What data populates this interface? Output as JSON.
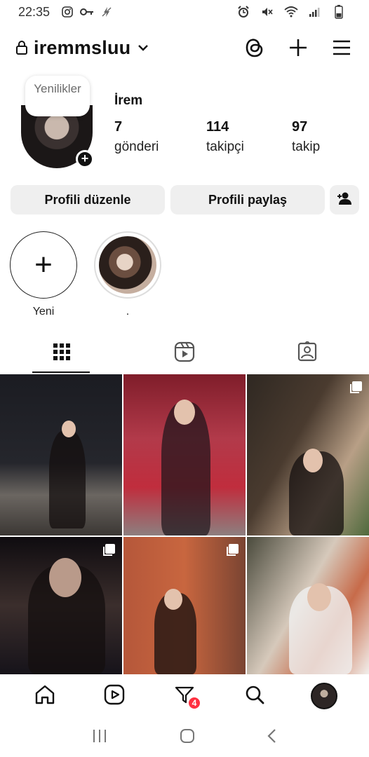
{
  "status_bar": {
    "time": "22:35",
    "left_icons": [
      "instagram-icon",
      "key-icon",
      "no-charge-icon"
    ],
    "right_icons": [
      "alarm-icon",
      "mute-icon",
      "wifi-icon",
      "signal-icon",
      "battery-icon"
    ]
  },
  "header": {
    "username": "iremmsluu",
    "actions": [
      "threads-icon",
      "plus-icon",
      "menu-icon"
    ]
  },
  "profile": {
    "note": "Yenilikler",
    "display_name": "İrem",
    "stats": [
      {
        "value": "7",
        "label": "gönderi"
      },
      {
        "value": "114",
        "label": "takipçi"
      },
      {
        "value": "97",
        "label": "takip"
      }
    ]
  },
  "buttons": {
    "edit": "Profili düzenle",
    "share": "Profili paylaş"
  },
  "highlights": [
    {
      "label": "Yeni"
    },
    {
      "label": "."
    }
  ],
  "tabs": [
    "grid-icon",
    "reels-icon",
    "tagged-icon"
  ],
  "grid_posts": [
    {
      "multi": false
    },
    {
      "multi": false
    },
    {
      "multi": true
    },
    {
      "multi": true
    },
    {
      "multi": true
    },
    {
      "multi": false
    }
  ],
  "bottom_nav": {
    "items": [
      "home-icon",
      "reels-icon",
      "heart-filter-icon",
      "search-icon",
      "profile-avatar"
    ],
    "badge": "4"
  },
  "colors": {
    "accent_badge": "#ff3040",
    "button_bg": "#efefef"
  }
}
